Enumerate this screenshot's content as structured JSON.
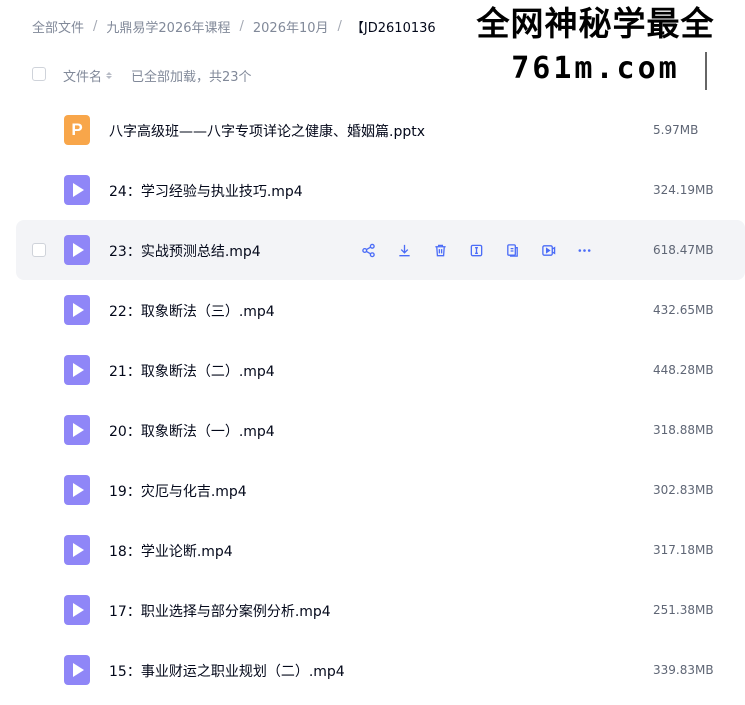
{
  "breadcrumb": {
    "items": [
      "全部文件",
      "九鼎易学2026年课程",
      "2026年10月",
      "【JD2610136"
    ],
    "separator": "/"
  },
  "watermark": {
    "line1": "全网神秘学最全",
    "line2": "761m.com"
  },
  "list_header": {
    "column_label": "文件名",
    "status": "已全部加载，共23个"
  },
  "colors": {
    "accent": "#4b6cf7",
    "video_icon": "#8f86f7",
    "pptx_icon": "#f8a64a",
    "hover_row": "#f3f4f7"
  },
  "files": [
    {
      "name": "八字高级班——八字专项详论之健康、婚姻篇.pptx",
      "size": "5.97MB",
      "type": "pptx",
      "icon": "pptx-icon"
    },
    {
      "name": "24：学习经验与执业技巧.mp4",
      "size": "324.19MB",
      "type": "video",
      "icon": "video-icon"
    },
    {
      "name": "23：实战预测总结.mp4",
      "size": "618.47MB",
      "type": "video",
      "icon": "video-icon",
      "hovered": true
    },
    {
      "name": "22：取象断法（三）.mp4",
      "size": "432.65MB",
      "type": "video",
      "icon": "video-icon"
    },
    {
      "name": "21：取象断法（二）.mp4",
      "size": "448.28MB",
      "type": "video",
      "icon": "video-icon"
    },
    {
      "name": "20：取象断法（一）.mp4",
      "size": "318.88MB",
      "type": "video",
      "icon": "video-icon"
    },
    {
      "name": "19：灾厄与化吉.mp4",
      "size": "302.83MB",
      "type": "video",
      "icon": "video-icon"
    },
    {
      "name": "18：学业论断.mp4",
      "size": "317.18MB",
      "type": "video",
      "icon": "video-icon"
    },
    {
      "name": "17：职业选择与部分案例分析.mp4",
      "size": "251.38MB",
      "type": "video",
      "icon": "video-icon"
    },
    {
      "name": "15：事业财运之职业规划（二）.mp4",
      "size": "339.83MB",
      "type": "video",
      "icon": "video-icon"
    }
  ],
  "row_actions": [
    "share-icon",
    "download-icon",
    "delete-icon",
    "rename-icon",
    "copy-icon",
    "play-icon",
    "more-icon"
  ]
}
